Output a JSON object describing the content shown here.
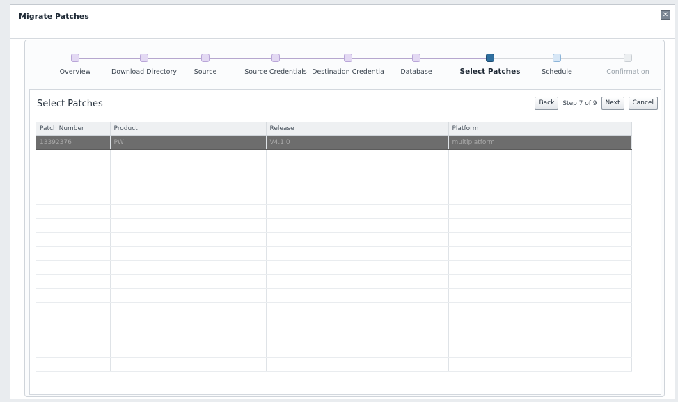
{
  "dialog": {
    "title": "Migrate Patches",
    "close_icon": "close-icon"
  },
  "train": {
    "stops": [
      {
        "label": "Overview",
        "state": "visited"
      },
      {
        "label": "Download Directory",
        "state": "visited"
      },
      {
        "label": "Source",
        "state": "visited"
      },
      {
        "label": "Source Credentials",
        "state": "visited"
      },
      {
        "label": "Destination Credentia",
        "state": "visited"
      },
      {
        "label": "Database",
        "state": "visited"
      },
      {
        "label": "Select Patches",
        "state": "current"
      },
      {
        "label": "Schedule",
        "state": "next"
      },
      {
        "label": "Confirmation",
        "state": "disabled"
      }
    ]
  },
  "panel": {
    "title": "Select Patches",
    "back_label": "Back",
    "step_text": "Step 7 of 9",
    "next_label": "Next",
    "cancel_label": "Cancel"
  },
  "table": {
    "columns": [
      "Patch Number",
      "Product",
      "Release",
      "Platform"
    ],
    "rows": [
      [
        "13392376",
        "PW",
        "V4.1.0",
        "multiplatform"
      ]
    ],
    "selected_row": 0,
    "empty_rows": 16
  },
  "colors": {
    "current_step": "#2f6f9f",
    "selected_row": "#6d6d6d"
  }
}
